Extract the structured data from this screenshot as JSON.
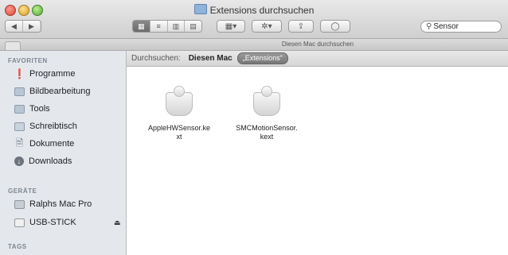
{
  "window": {
    "title": "Extensions durchsuchen",
    "colors": {
      "sidebar_bg": "#e4e8ed",
      "toolbar_bg": "#d6d6d6",
      "chip_bg": "#888888"
    }
  },
  "toolbar": {
    "nav_back_icon": "◀",
    "nav_forward_icon": "▶",
    "view_icons": [
      "▦",
      "≡",
      "▥",
      "▤"
    ],
    "arrange_icon": "▦▾",
    "action_icon": "✲▾",
    "share_icon": "⇪",
    "tag_icon": "◯"
  },
  "search": {
    "value": "Sensor",
    "icon": "search-icon"
  },
  "scope_title": "Diesen Mac durchsuchen",
  "pathbar": {
    "label": "Durchsuchen:",
    "location": "Diesen Mac",
    "chip": "„Extensions“"
  },
  "sidebar": {
    "favorites_heading": "FAVORITEN",
    "favorites": [
      {
        "label": "Programme",
        "icon": "apps-icon"
      },
      {
        "label": "Bildbearbeitung",
        "icon": "folder-icon"
      },
      {
        "label": "Tools",
        "icon": "folder-icon"
      },
      {
        "label": "Schreibtisch",
        "icon": "desktop-icon"
      },
      {
        "label": "Dokumente",
        "icon": "document-icon"
      },
      {
        "label": "Downloads",
        "icon": "downloads-icon"
      }
    ],
    "devices_heading": "GERÄTE",
    "devices": [
      {
        "label": "Ralphs Mac Pro",
        "icon": "computer-icon"
      },
      {
        "label": "USB-STICK",
        "icon": "drive-icon"
      }
    ],
    "eject_icon": "⏏",
    "tags_heading": "TAGS"
  },
  "files": [
    {
      "name_line1": "AppleHWSensor.ke",
      "name_line2": "xt"
    },
    {
      "name_line1": "SMCMotionSensor.",
      "name_line2": "kext"
    }
  ]
}
